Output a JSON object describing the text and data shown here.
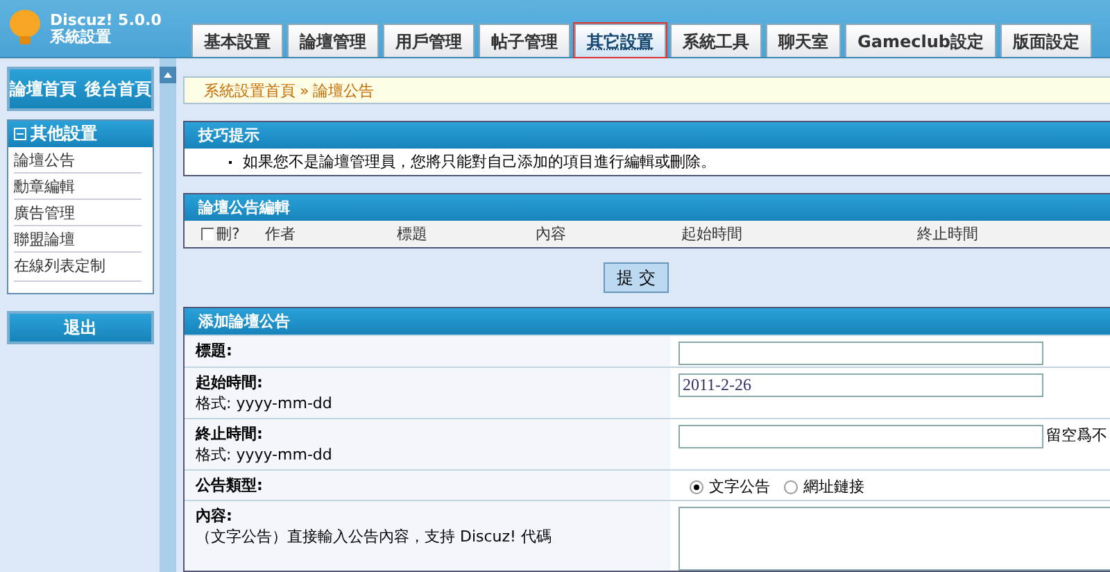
{
  "header": {
    "product": "Discuz! 5.0.0",
    "subtitle": "系統設置"
  },
  "tabs": [
    {
      "label": "基本設置",
      "selected": false
    },
    {
      "label": "論壇管理",
      "selected": false
    },
    {
      "label": "用戶管理",
      "selected": false
    },
    {
      "label": "帖子管理",
      "selected": false
    },
    {
      "label": "其它設置",
      "selected": true
    },
    {
      "label": "系統工具",
      "selected": false
    },
    {
      "label": "聊天室",
      "selected": false
    },
    {
      "label": "Gameclub設定",
      "selected": false
    },
    {
      "label": "版面設定",
      "selected": false
    }
  ],
  "sidebar": {
    "home_links": [
      "論壇首頁",
      "後台首頁"
    ],
    "section": {
      "title": "其他設置",
      "expanded": true,
      "items": [
        "論壇公告",
        "勳章編輯",
        "廣告管理",
        "聯盟論壇",
        "在線列表定制"
      ]
    },
    "logout": "退出"
  },
  "breadcrumb": [
    "系統設置首頁",
    "論壇公告"
  ],
  "breadcrumb_separator": "»",
  "tips": {
    "title": "技巧提示",
    "items": [
      "如果您不是論壇管理員，您將只能對自己添加的項目進行編輯或刪除。"
    ]
  },
  "edit_table": {
    "title": "論壇公告編輯",
    "delete_label": "刪?",
    "delete_checked": false,
    "columns": [
      "作者",
      "標題",
      "內容",
      "起始時間",
      "終止時間"
    ]
  },
  "submit_button": "提 交",
  "add_form": {
    "title": "添加論壇公告",
    "rows": [
      {
        "kind": "text",
        "label": "標題:",
        "value": ""
      },
      {
        "kind": "text",
        "label": "起始時間:",
        "hint": "格式: yyyy-mm-dd",
        "value": "2011-2-26"
      },
      {
        "kind": "text",
        "label": "終止時間:",
        "hint": "格式: yyyy-mm-dd",
        "value": "",
        "note": "留空爲不"
      },
      {
        "kind": "radio",
        "label": "公告類型:",
        "options": [
          {
            "label": "文字公告",
            "selected": true
          },
          {
            "label": "網址鏈接",
            "selected": false
          }
        ]
      },
      {
        "kind": "textarea",
        "label": "內容:",
        "hint": "（文字公告）直接輸入公告內容，支持 Discuz! 代碼",
        "value": ""
      }
    ]
  }
}
